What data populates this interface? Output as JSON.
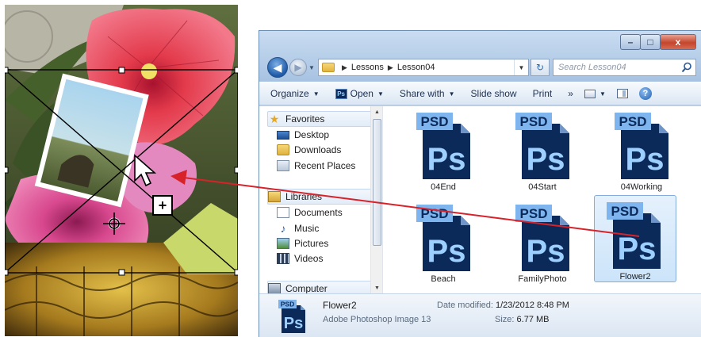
{
  "explorer": {
    "window_controls": {
      "minimize": "–",
      "maximize": "□",
      "close": "x"
    },
    "breadcrumb": [
      "Lessons",
      "Lesson04"
    ],
    "search_placeholder": "Search Lesson04",
    "toolbar": {
      "organize": "Organize",
      "open": "Open",
      "share_with": "Share with",
      "slide_show": "Slide show",
      "print": "Print",
      "more": "»"
    },
    "nav_pane": {
      "favorites": "Favorites",
      "desktop": "Desktop",
      "downloads": "Downloads",
      "recent_places": "Recent Places",
      "libraries": "Libraries",
      "documents": "Documents",
      "music": "Music",
      "pictures": "Pictures",
      "videos": "Videos",
      "computer": "Computer"
    },
    "icon_badge": "PSD",
    "icon_glyph": "Ps",
    "files": [
      {
        "name": "04End",
        "selected": false
      },
      {
        "name": "04Start",
        "selected": false
      },
      {
        "name": "04Working",
        "selected": false
      },
      {
        "name": "Beach",
        "selected": false
      },
      {
        "name": "FamilyPhoto",
        "selected": false
      },
      {
        "name": "Flower2",
        "selected": true
      }
    ],
    "details": {
      "name": "Flower2",
      "type": "Adobe Photoshop Image 13",
      "date_modified_label": "Date modified:",
      "date_modified_value": "1/23/2012 8:48 PM",
      "size_label": "Size:",
      "size_value": "6.77 MB"
    }
  },
  "canvas": {
    "cursor_badge": "+"
  },
  "colors": {
    "psd_dark": "#0c2a59",
    "psd_light": "#7fb5ee",
    "drag_line": "#d8222a",
    "selection_bg": "#cce4fa"
  }
}
